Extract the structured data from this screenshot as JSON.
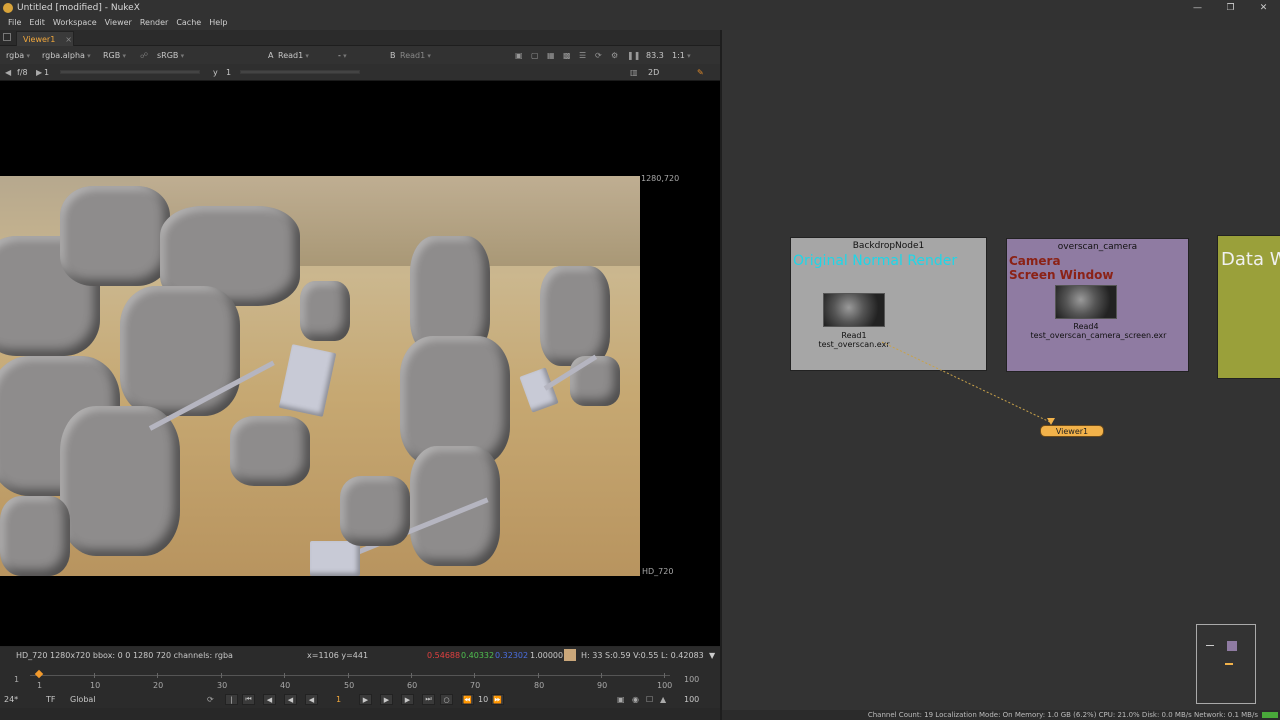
{
  "window": {
    "title": "Untitled [modified] - NukeX"
  },
  "menu": [
    "File",
    "Edit",
    "Workspace",
    "Viewer",
    "Render",
    "Cache",
    "Help"
  ],
  "viewer": {
    "tab_label": "Viewer1",
    "tab_close": "×",
    "toolbar": {
      "channels": "rgba",
      "alpha_channel": "rgba.alpha",
      "display": "RGB",
      "lut": "sRGB",
      "input_a_prefix": "A",
      "input_a": "Read1",
      "compare_mode": "-",
      "input_b_prefix": "B",
      "input_b": "Read1",
      "zoom": "83.3",
      "proxy": "1:1"
    },
    "toolbar2": {
      "fstop": "f/8",
      "gain": "1",
      "y_label": "y",
      "gamma": "1",
      "view_mode": "2D"
    },
    "format_top_right": "1280,720",
    "format_bottom": "HD_720",
    "info": {
      "format": "HD_720 1280x720  bbox: 0 0 1280 720 channels: rgba",
      "coords": "x=1106 y=441",
      "r": "0.54688",
      "g": "0.40332",
      "b": "0.32302",
      "a": "1.00000",
      "hsvl": "H: 33 S:0.59 V:0.55  L: 0.42083",
      "swatch_color": "#caa77a"
    },
    "timeline": {
      "start": "1",
      "end": "100",
      "ticks": [
        "10",
        "20",
        "30",
        "40",
        "50",
        "60",
        "70",
        "80",
        "90",
        "100"
      ],
      "first": "1"
    },
    "transport": {
      "fps": "24*",
      "tf": "TF",
      "scope": "Global",
      "current_frame": "1",
      "increment": "10",
      "end_frame": "100"
    }
  },
  "nodegraph": {
    "backdrop1": {
      "title": "BackdropNode1",
      "label": "Original Normal Render",
      "bg": "#a6a6a6",
      "label_color": "#1fd6e8"
    },
    "backdrop2": {
      "title": "overscan_camera",
      "label_line1": "Camera",
      "label_line2": "Screen Window",
      "bg": "#8f7ba2",
      "label_color": "#8b2216"
    },
    "backdrop3": {
      "label": "Data W",
      "bg": "#9aa03a"
    },
    "read1": {
      "name": "Read1",
      "file": "test_overscan.exr"
    },
    "read4": {
      "name": "Read4",
      "file": "test_overscan_camera_screen.exr"
    },
    "viewer_node": "Viewer1"
  },
  "status": "Channel Count: 19 Localization Mode: On Memory: 1.0 GB (6.2%) CPU: 21.0% Disk: 0.0 MB/s Network: 0.1 MB/s"
}
